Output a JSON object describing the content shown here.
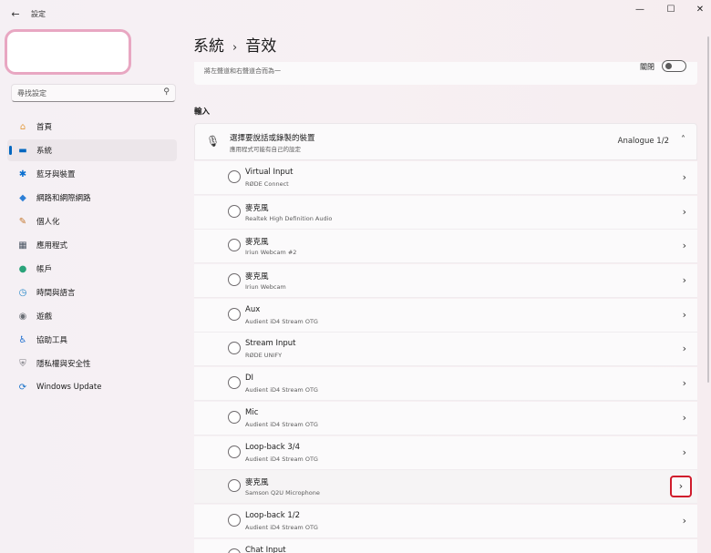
{
  "window": {
    "title": "設定",
    "back_glyph": "←",
    "minimize_glyph": "—",
    "maximize_glyph": "☐",
    "close_glyph": "✕"
  },
  "search": {
    "placeholder": "尋找設定",
    "icon": "search-icon"
  },
  "sidebar": {
    "items": [
      {
        "label": "首頁",
        "icon": "home-icon",
        "glyph": "⌂",
        "color": "#e39b3e"
      },
      {
        "label": "系統",
        "icon": "system-display-icon",
        "glyph": "▬",
        "color": "#0067c0",
        "active": true
      },
      {
        "label": "藍牙與裝置",
        "icon": "bluetooth-icon",
        "glyph": "✱",
        "color": "#0a6fd0"
      },
      {
        "label": "網路和網際網路",
        "icon": "wifi-icon",
        "glyph": "◆",
        "color": "#2d7fd6"
      },
      {
        "label": "個人化",
        "icon": "paintbrush-icon",
        "glyph": "✎",
        "color": "#c4762c"
      },
      {
        "label": "應用程式",
        "icon": "apps-icon",
        "glyph": "▦",
        "color": "#4b5563"
      },
      {
        "label": "帳戶",
        "icon": "account-icon",
        "glyph": "●",
        "color": "#2aa37a"
      },
      {
        "label": "時間與語言",
        "icon": "clock-globe-icon",
        "glyph": "◷",
        "color": "#1f84c7"
      },
      {
        "label": "遊戲",
        "icon": "gamepad-icon",
        "glyph": "◉",
        "color": "#6b6f76"
      },
      {
        "label": "協助工具",
        "icon": "accessibility-icon",
        "glyph": "♿",
        "color": "#1e6fd0"
      },
      {
        "label": "隱私權與安全性",
        "icon": "shield-icon",
        "glyph": "⛨",
        "color": "#7a7a80"
      },
      {
        "label": "Windows Update",
        "icon": "update-icon",
        "glyph": "⟳",
        "color": "#1a73c9"
      }
    ]
  },
  "header": {
    "parent": "系統",
    "separator": "›",
    "current": "音效"
  },
  "top_card": {
    "description": "將左聲道和右聲道合而為一",
    "toggle_label": "關閉",
    "toggle_on": false
  },
  "input_section": {
    "title": "輸入",
    "device_header": {
      "title": "選擇要說話或錄製的裝置",
      "subtitle": "應用程式可能有自己的設定",
      "selected": "Analogue 1/2",
      "chevron": "˄"
    },
    "devices": [
      {
        "name": "Virtual Input",
        "sub": "RØDE Connect"
      },
      {
        "name": "麥克風",
        "sub": "Realtek High Definition Audio"
      },
      {
        "name": "麥克風",
        "sub": "Iriun Webcam #2"
      },
      {
        "name": "麥克風",
        "sub": "Iriun Webcam"
      },
      {
        "name": "Aux",
        "sub": "Audient iD4 Stream OTG"
      },
      {
        "name": "Stream Input",
        "sub": "RØDE UNIFY"
      },
      {
        "name": "DI",
        "sub": "Audient iD4 Stream OTG"
      },
      {
        "name": "Mic",
        "sub": "Audient iD4 Stream OTG"
      },
      {
        "name": "Loop-back 3/4",
        "sub": "Audient iD4 Stream OTG"
      },
      {
        "name": "麥克風",
        "sub": "Samson Q2U Microphone",
        "highlighted": true
      },
      {
        "name": "Loop-back 1/2",
        "sub": "Audient iD4 Stream OTG"
      },
      {
        "name": "Chat Input",
        "sub": ""
      }
    ],
    "row_chevron": "›"
  },
  "colors": {
    "accent": "#0067c0",
    "highlight_border": "#d01c2c",
    "avatar_border": "#e8a7c2"
  }
}
